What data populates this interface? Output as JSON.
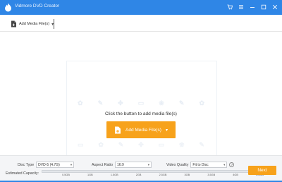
{
  "window": {
    "title": "Vidmore DVD Creator",
    "controls": [
      "cart-icon",
      "menu-icon",
      "minimize-icon",
      "maximize-icon",
      "close-icon"
    ],
    "accent_color": "#2f86e6"
  },
  "toolbar": {
    "add_file_label": "Add Media File(s)"
  },
  "main": {
    "prompt": "Click the button to add media file(s)",
    "add_button_label": "Add Media File(s)",
    "button_color": "#f7a21b"
  },
  "bottombar": {
    "disc_type": {
      "label": "Disc Type",
      "value": "DVD-5 (4.7G)"
    },
    "aspect_ratio": {
      "label": "Aspect Ratio",
      "value": "16:9"
    },
    "video_quality": {
      "label": "Video Quality",
      "value": "Fit to Disc"
    },
    "capacity": {
      "label": "Estimated Capacity:",
      "ticks": [
        "0.5GB",
        "1GB",
        "1.5GB",
        "2GB",
        "2.5GB",
        "3GB",
        "3.5GB",
        "4GB",
        "4.5GB"
      ],
      "used_fraction": 0
    },
    "next_label": "Next"
  }
}
